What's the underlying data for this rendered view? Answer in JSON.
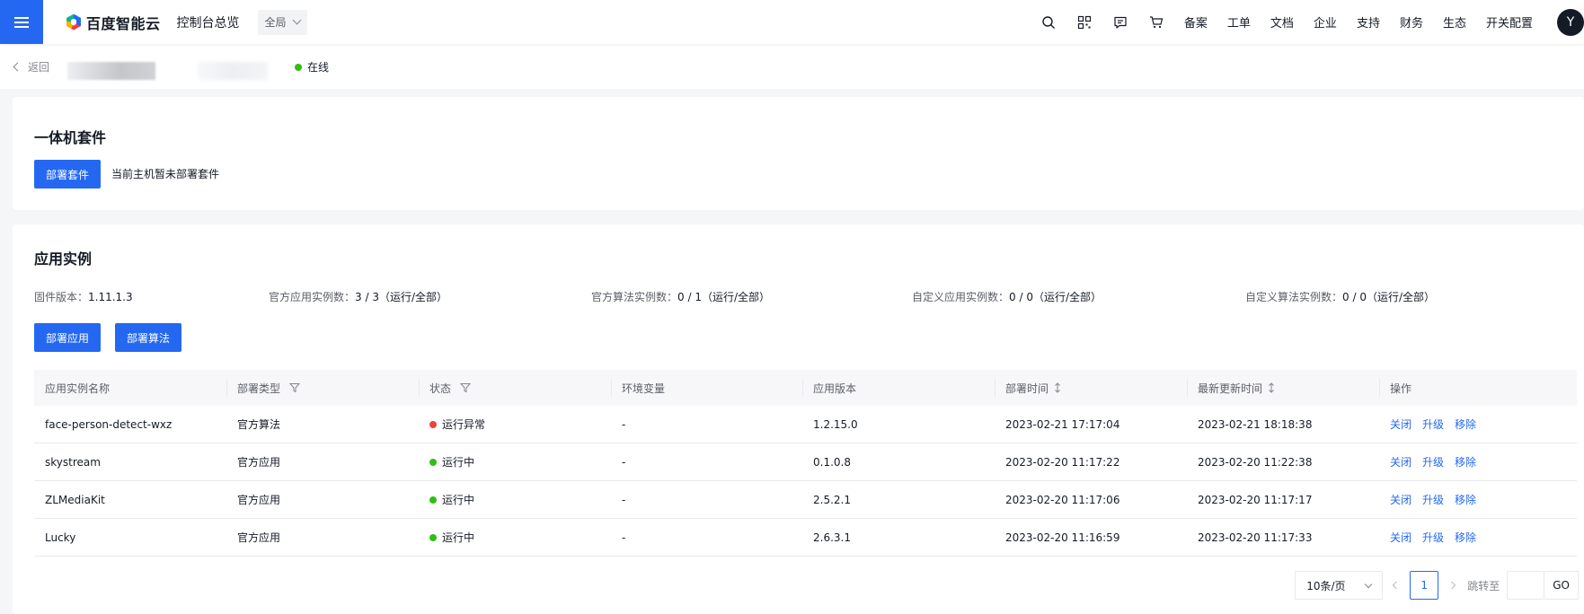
{
  "nav": {
    "logo_text": "百度智能云",
    "console_title": "控制台总览",
    "region": "全局",
    "links": [
      "备案",
      "工单",
      "文档",
      "企业",
      "支持",
      "财务",
      "生态",
      "开关配置"
    ],
    "avatar_letter": "Y"
  },
  "subheader": {
    "back_label": "返回",
    "status_text": "在线",
    "status_color": "#30bf13"
  },
  "suite": {
    "title": "一体机套件",
    "deploy_button": "部署套件",
    "hint": "当前主机暂未部署套件"
  },
  "apps": {
    "title": "应用实例",
    "stats": [
      {
        "label": "固件版本：",
        "value": "1.11.1.3"
      },
      {
        "label": "官方应用实例数：",
        "value": "3 / 3（运行/全部）"
      },
      {
        "label": "官方算法实例数：",
        "value": "0 / 1（运行/全部）"
      },
      {
        "label": "自定义应用实例数：",
        "value": "0 / 0（运行/全部）"
      },
      {
        "label": "自定义算法实例数：",
        "value": "0 / 0（运行/全部）"
      }
    ],
    "deploy_app_button": "部署应用",
    "deploy_algo_button": "部署算法",
    "columns": [
      "应用实例名称",
      "部署类型",
      "状态",
      "环境变量",
      "应用版本",
      "部署时间",
      "最新更新时间",
      "操作"
    ],
    "rows": [
      {
        "name": "face-person-detect-wxz",
        "type": "官方算法",
        "status": "运行异常",
        "status_color": "#f33e3e",
        "env": "-",
        "version": "1.2.15.0",
        "deploy_time": "2023-02-21 17:17:04",
        "update_time": "2023-02-21 18:18:38"
      },
      {
        "name": "skystream",
        "type": "官方应用",
        "status": "运行中",
        "status_color": "#30bf13",
        "env": "-",
        "version": "0.1.0.8",
        "deploy_time": "2023-02-20 11:17:22",
        "update_time": "2023-02-20 11:22:38"
      },
      {
        "name": "ZLMediaKit",
        "type": "官方应用",
        "status": "运行中",
        "status_color": "#30bf13",
        "env": "-",
        "version": "2.5.2.1",
        "deploy_time": "2023-02-20 11:17:06",
        "update_time": "2023-02-20 11:17:17"
      },
      {
        "name": "Lucky",
        "type": "官方应用",
        "status": "运行中",
        "status_color": "#30bf13",
        "env": "-",
        "version": "2.6.3.1",
        "deploy_time": "2023-02-20 11:16:59",
        "update_time": "2023-02-20 11:17:33"
      }
    ],
    "row_actions": [
      "关闭",
      "升级",
      "移除"
    ]
  },
  "pager": {
    "page_size": "10条/页",
    "current_page": "1",
    "jump_label": "跳转至",
    "go_label": "GO"
  }
}
